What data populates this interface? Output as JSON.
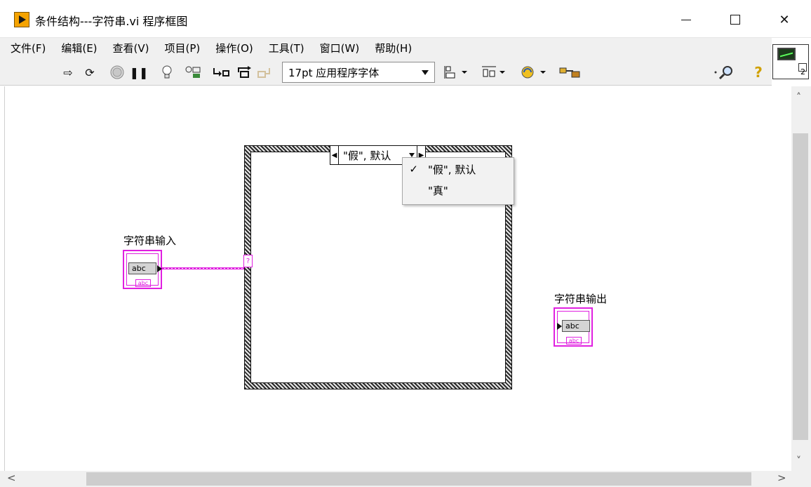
{
  "window": {
    "title": "条件结构---字符串.vi 程序框图"
  },
  "menubar": {
    "items": [
      "文件(F)",
      "编辑(E)",
      "查看(V)",
      "项目(P)",
      "操作(O)",
      "工具(T)",
      "窗口(W)",
      "帮助(H)"
    ]
  },
  "toolbar": {
    "font_select": "17pt 应用程序字体",
    "connector_number": "2"
  },
  "icons": {
    "run": "run-arrow-icon",
    "run_continuous": "run-continuous-icon",
    "abort": "abort-icon",
    "pause": "pause-icon",
    "highlight": "lightbulb-icon",
    "retain_wire": "retain-wire-values-icon",
    "step_into": "step-into-icon",
    "step_over": "step-over-icon",
    "step_out": "step-out-icon",
    "align": "align-objects-icon",
    "distribute": "distribute-objects-icon",
    "reorder": "reorder-icon",
    "cleanup": "cleanup-diagram-icon",
    "search": "search-icon",
    "help": "help-icon"
  },
  "case_structure": {
    "selector_label": "\"假\", 默认",
    "dropdown": [
      {
        "label": "\"假\", 默认",
        "checked": true
      },
      {
        "label": "\"真\"",
        "checked": false
      }
    ],
    "tunnel_glyph": "?"
  },
  "terminals": {
    "input_label": "字符串输入",
    "output_label": "字符串输出",
    "type_text": "abc",
    "wire_color": "#e020e0"
  },
  "scrollbars": {
    "up": "˄",
    "down": "˅",
    "left": "<",
    "right": ">"
  }
}
